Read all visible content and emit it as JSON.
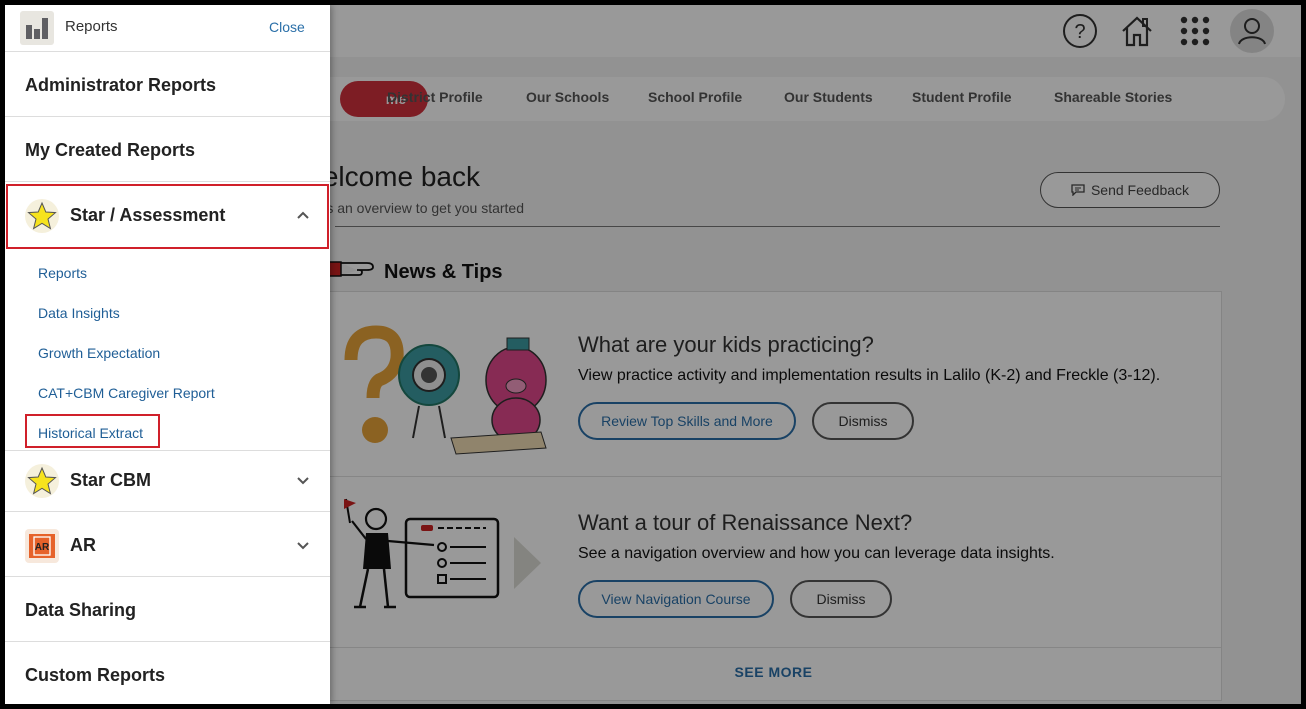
{
  "drawer": {
    "title": "Reports",
    "close_label": "Close",
    "sections": [
      {
        "label": "Administrator Reports"
      },
      {
        "label": "My Created Reports"
      },
      {
        "label": "Star / Assessment",
        "icon": "star-icon",
        "expanded": true
      },
      {
        "label": "Star CBM",
        "icon": "star-icon",
        "expanded": false
      },
      {
        "label": "AR",
        "icon": "ar-icon",
        "expanded": false
      },
      {
        "label": "Data Sharing"
      },
      {
        "label": "Custom Reports"
      }
    ],
    "star_assessment_items": [
      {
        "label": "Reports"
      },
      {
        "label": "Data Insights"
      },
      {
        "label": "Growth Expectation"
      },
      {
        "label": "CAT+CBM Caregiver Report"
      },
      {
        "label": "Historical Extract",
        "highlighted": true
      }
    ]
  },
  "topbar": {
    "icons": [
      "help-icon",
      "home-icon",
      "apps-grid-icon",
      "user-avatar-icon"
    ]
  },
  "tabs": {
    "active_partial": "me",
    "items": [
      {
        "label": "District Profile"
      },
      {
        "label": "Our Schools"
      },
      {
        "label": "School Profile"
      },
      {
        "label": "Our Students"
      },
      {
        "label": "Student Profile"
      },
      {
        "label": "Shareable Stories"
      }
    ]
  },
  "welcome": {
    "title_visible": "elcome back",
    "subtitle_visible": "s an overview to get you started",
    "feedback_label": "Send Feedback"
  },
  "news": {
    "title": "News & Tips",
    "cards": [
      {
        "title": "What are your kids practicing?",
        "text": "View practice activity and implementation results in Lalilo (K-2) and Freckle (3-12).",
        "primary_label": "Review Top Skills and More",
        "dismiss_label": "Dismiss"
      },
      {
        "title": "Want a tour of Renaissance Next?",
        "text": "See a navigation overview and how you can leverage data insights.",
        "primary_label": "View Navigation Course",
        "dismiss_label": "Dismiss"
      }
    ],
    "see_more_label": "SEE MORE"
  },
  "colors": {
    "accent_red": "#d1313d",
    "link_blue": "#1f5e96",
    "highlight_box": "#d0202a"
  }
}
